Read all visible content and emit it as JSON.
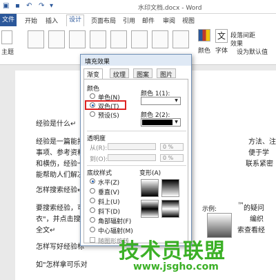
{
  "window": {
    "title": "水印文档.docx - Word"
  },
  "ribbon": {
    "tabs": [
      "文件",
      "开始",
      "插入",
      "设计",
      "页面布局",
      "引用",
      "邮件",
      "审阅",
      "视图"
    ],
    "active_tab": "设计",
    "theme_label": "主题",
    "colors_label": "颜色",
    "fonts_label": "字体",
    "paragraph_spacing_label": "段落间距",
    "effects_label": "效果",
    "set_default_label": "设为默认值"
  },
  "document": {
    "lines": [
      "经验是什么↵",
      "经验是一篇能指导",
      "事项、参考资料等",
      "和横伤，经验一篇",
      "能帮助人们解决实",
      "怎样搜索经验↵",
      "要搜索经验，可以",
      "衣\"，并点击搜索",
      "全文↵",
      "怎样写好经验标",
      "如\"怎样拿可乐对"
    ],
    "right_fragments": [
      "方法、注",
      "便于学",
      "联系紧密",
      "编织",
      "索查看经",
      "的疑问"
    ],
    "right_fragment_tag": "™"
  },
  "dialog": {
    "title": "填充效果",
    "tabs": [
      "渐变",
      "纹理",
      "图案",
      "图片"
    ],
    "active_tab": "渐变",
    "colors_group": "颜色",
    "color_options": [
      "单色(N)",
      "双色(T)",
      "预设(S)"
    ],
    "selected_color_option": "双色(T)",
    "color1_label": "颜色 1(1):",
    "color2_label": "颜色 2(2):",
    "color1_value": "#ffffff",
    "color2_value": "#000000",
    "transparency_group": "透明度",
    "from_label": "从(R):",
    "to_label": "到(O):",
    "from_value": "0 %",
    "to_value": "0 %",
    "shading_group": "底纹样式",
    "shading_options": [
      "水平(Z)",
      "垂直(V)",
      "斜上(U)",
      "斜下(D)",
      "角部辐射(F)",
      "中心辐射(M)"
    ],
    "selected_shading": "水平(Z)",
    "variants_label": "变形(A)",
    "sample_label": "示例:",
    "rotate_label": "随图形旋转"
  },
  "watermark": {
    "text": "技术员联盟",
    "url": "www.jsgho.com"
  }
}
